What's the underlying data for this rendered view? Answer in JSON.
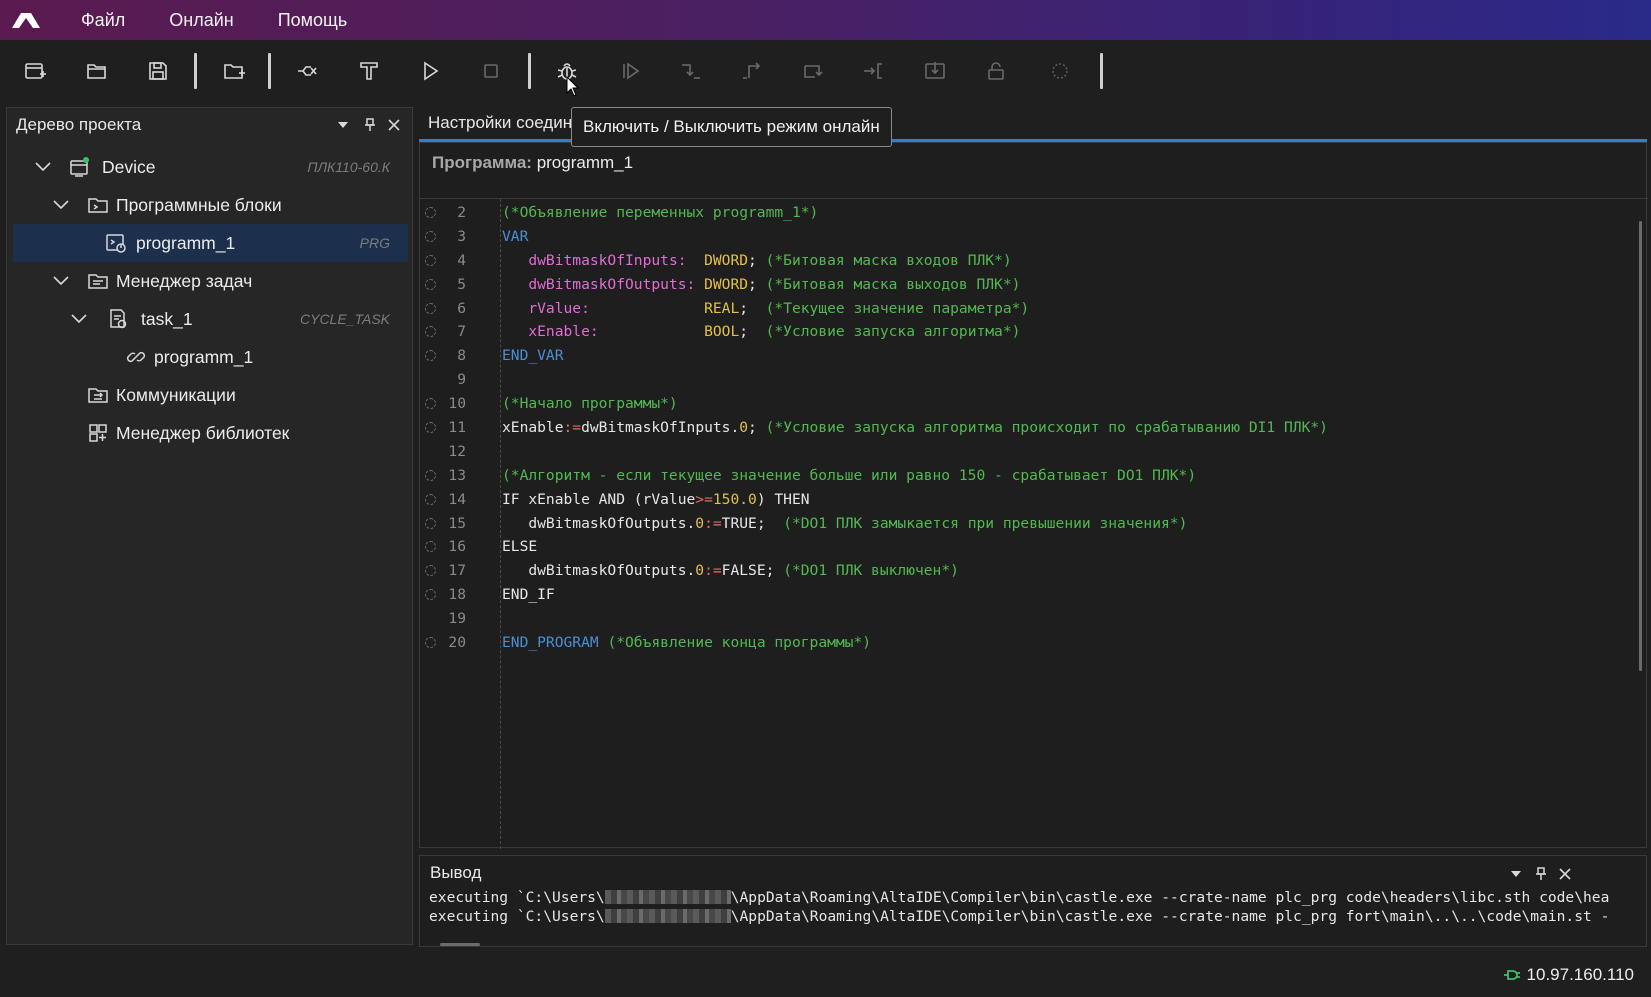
{
  "menu": {
    "items": [
      "Файл",
      "Онлайн",
      "Помощь"
    ]
  },
  "toolbar": {
    "icons": [
      "new-project-icon",
      "open-folder-icon",
      "save-icon",
      "add-device-icon",
      "build-icon",
      "format-icon",
      "run-icon",
      "stop-icon",
      "online-bug-icon",
      "resume-icon",
      "step-over-icon",
      "step-out-icon",
      "step-into-icon",
      "step-in-bracket-icon",
      "download-icon",
      "unlock-icon",
      "spinner-icon"
    ],
    "tooltip": "Включить / Выключить режим онлайн"
  },
  "tree": {
    "title": "Дерево проекта",
    "items": [
      {
        "label": "Device",
        "meta": "ПЛК110-60.К",
        "icon": "device-icon"
      },
      {
        "label": "Программные блоки",
        "meta": "",
        "icon": "program-blocks-icon"
      },
      {
        "label": "programm_1",
        "meta": "PRG",
        "icon": "program-icon"
      },
      {
        "label": "Менеджер задач",
        "meta": "",
        "icon": "task-manager-icon"
      },
      {
        "label": "task_1",
        "meta": "CYCLE_TASK",
        "icon": "task-icon"
      },
      {
        "label": "programm_1",
        "meta": "",
        "icon": "link-icon"
      },
      {
        "label": "Коммуникации",
        "meta": "",
        "icon": "communications-icon"
      },
      {
        "label": "Менеджер библиотек",
        "meta": "",
        "icon": "library-icon"
      }
    ]
  },
  "editor": {
    "tab_label": "Настройки соедин",
    "program_label": "Программа:",
    "program_name": "programm_1",
    "lines": [
      {
        "n": "2",
        "bp": true,
        "tokens": [
          [
            "cm",
            "(*Объявление переменных programm_1*)"
          ]
        ]
      },
      {
        "n": "3",
        "bp": true,
        "tokens": [
          [
            "kw",
            "VAR"
          ]
        ]
      },
      {
        "n": "4",
        "bp": true,
        "tokens": [
          [
            "plain",
            "   "
          ],
          [
            "var",
            "dwBitmaskOfInputs:"
          ],
          [
            "plain",
            "  "
          ],
          [
            "type",
            "DWORD"
          ],
          [
            "plain",
            "; "
          ],
          [
            "cm",
            "(*Битовая маска входов ПЛК*)"
          ]
        ]
      },
      {
        "n": "5",
        "bp": true,
        "tokens": [
          [
            "plain",
            "   "
          ],
          [
            "var",
            "dwBitmaskOfOutputs:"
          ],
          [
            "plain",
            " "
          ],
          [
            "type",
            "DWORD"
          ],
          [
            "plain",
            "; "
          ],
          [
            "cm",
            "(*Битовая маска выходов ПЛК*)"
          ]
        ]
      },
      {
        "n": "6",
        "bp": true,
        "tokens": [
          [
            "plain",
            "   "
          ],
          [
            "var",
            "rValue:"
          ],
          [
            "plain",
            "             "
          ],
          [
            "type",
            "REAL"
          ],
          [
            "plain",
            ";  "
          ],
          [
            "cm",
            "(*Текущее значение параметра*)"
          ]
        ]
      },
      {
        "n": "7",
        "bp": true,
        "tokens": [
          [
            "plain",
            "   "
          ],
          [
            "var",
            "xEnable:"
          ],
          [
            "plain",
            "            "
          ],
          [
            "type",
            "BOOL"
          ],
          [
            "plain",
            ";  "
          ],
          [
            "cm",
            "(*Условие запуска алгоритма*)"
          ]
        ]
      },
      {
        "n": "8",
        "bp": true,
        "tokens": [
          [
            "kw",
            "END_VAR"
          ]
        ]
      },
      {
        "n": "9",
        "bp": false,
        "tokens": []
      },
      {
        "n": "10",
        "bp": true,
        "tokens": [
          [
            "cm",
            "(*Начало программы*)"
          ]
        ]
      },
      {
        "n": "11",
        "bp": true,
        "tokens": [
          [
            "plain",
            "xEnable"
          ],
          [
            "op",
            ":="
          ],
          [
            "plain",
            "dwBitmaskOfInputs."
          ],
          [
            "num",
            "0"
          ],
          [
            "plain",
            "; "
          ],
          [
            "cm",
            "(*Условие запуска алгоритма происходит по срабатыванию DI1 ПЛК*)"
          ]
        ]
      },
      {
        "n": "12",
        "bp": false,
        "tokens": []
      },
      {
        "n": "13",
        "bp": true,
        "tokens": [
          [
            "cm",
            "(*Алгоритм - если текущее значение больше или равно 150 - срабатывает DO1 ПЛК*)"
          ]
        ]
      },
      {
        "n": "14",
        "bp": true,
        "tokens": [
          [
            "plain",
            "IF xEnable AND (rValue"
          ],
          [
            "op",
            ">="
          ],
          [
            "num",
            "150.0"
          ],
          [
            "plain",
            ") THEN"
          ]
        ]
      },
      {
        "n": "15",
        "bp": true,
        "tokens": [
          [
            "plain",
            "   dwBitmaskOfOutputs."
          ],
          [
            "num",
            "0"
          ],
          [
            "op",
            ":="
          ],
          [
            "plain",
            "TRUE;  "
          ],
          [
            "cm",
            "(*DO1 ПЛК замыкается при превышении значения*)"
          ]
        ]
      },
      {
        "n": "16",
        "bp": true,
        "tokens": [
          [
            "plain",
            "ELSE"
          ]
        ]
      },
      {
        "n": "17",
        "bp": true,
        "tokens": [
          [
            "plain",
            "   dwBitmaskOfOutputs."
          ],
          [
            "num",
            "0"
          ],
          [
            "op",
            ":="
          ],
          [
            "plain",
            "FALSE; "
          ],
          [
            "cm",
            "(*DO1 ПЛК выключен*)"
          ]
        ]
      },
      {
        "n": "18",
        "bp": true,
        "tokens": [
          [
            "plain",
            "END_IF"
          ]
        ]
      },
      {
        "n": "19",
        "bp": false,
        "tokens": []
      },
      {
        "n": "20",
        "bp": true,
        "tokens": [
          [
            "kw",
            "END_PROGRAM"
          ],
          [
            "plain",
            " "
          ],
          [
            "cm",
            "(*Объявление конца программы*)"
          ]
        ]
      }
    ]
  },
  "output": {
    "title": "Вывод",
    "lines": [
      {
        "pre": "executing `C:\\Users\\",
        "post": "\\AppData\\Roaming\\AltaIDE\\Compiler\\bin\\castle.exe --crate-name plc_prg code\\headers\\libc.sth code\\hea"
      },
      {
        "pre": "executing `C:\\Users\\",
        "post": "\\AppData\\Roaming\\AltaIDE\\Compiler\\bin\\castle.exe --crate-name plc_prg fort\\main\\..\\..\\code\\main.st -"
      }
    ]
  },
  "status": {
    "ip": "10.97.160.110"
  },
  "colors": {
    "accent": "#2f7fd0",
    "selected": "#1c2f4d",
    "ok": "#3fbf6a"
  }
}
